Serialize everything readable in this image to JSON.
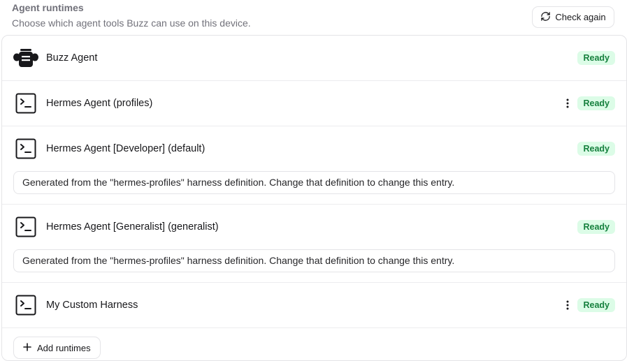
{
  "header": {
    "title": "Agent runtimes",
    "subtitle": "Choose which agent tools Buzz can use on this device.",
    "check_again_label": "Check again"
  },
  "runtimes": [
    {
      "label": "Buzz Agent",
      "icon": "bee-icon",
      "status": "Ready",
      "has_menu": false,
      "note": ""
    },
    {
      "label": "Hermes Agent (profiles)",
      "icon": "terminal-icon",
      "status": "Ready",
      "has_menu": true,
      "note": ""
    },
    {
      "label": "Hermes Agent [Developer] (default)",
      "icon": "terminal-icon",
      "status": "Ready",
      "has_menu": false,
      "note": "Generated from the \"hermes-profiles\" harness definition. Change that definition to change this entry."
    },
    {
      "label": "Hermes Agent [Generalist] (generalist)",
      "icon": "terminal-icon",
      "status": "Ready",
      "has_menu": false,
      "note": "Generated from the \"hermes-profiles\" harness definition. Change that definition to change this entry."
    },
    {
      "label": "My Custom Harness",
      "icon": "terminal-icon",
      "status": "Ready",
      "has_menu": true,
      "note": ""
    }
  ],
  "add_runtimes_label": "Add runtimes",
  "colors": {
    "ready_bg": "#dcfce7",
    "ready_text": "#15803d",
    "border": "#e4e4e7"
  }
}
